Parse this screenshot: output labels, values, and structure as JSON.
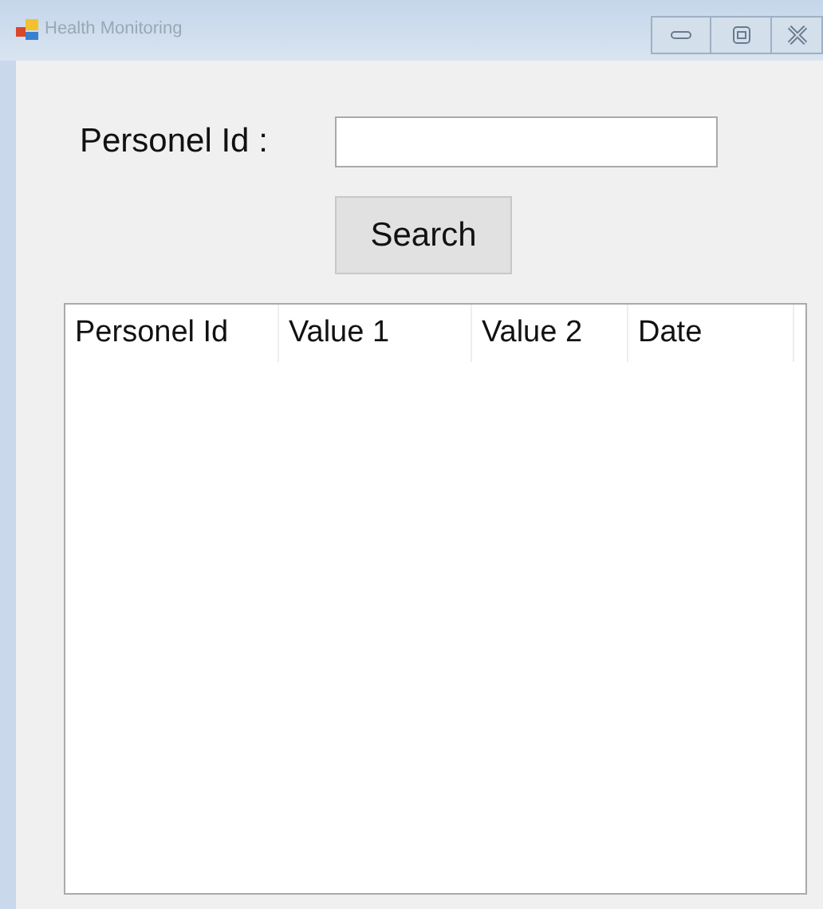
{
  "window": {
    "title": "Health Monitoring"
  },
  "form": {
    "label": "Personel Id :",
    "button": "Search"
  },
  "table": {
    "columns": [
      "Personel Id",
      "Value 1",
      "Value 2",
      "Date"
    ]
  }
}
